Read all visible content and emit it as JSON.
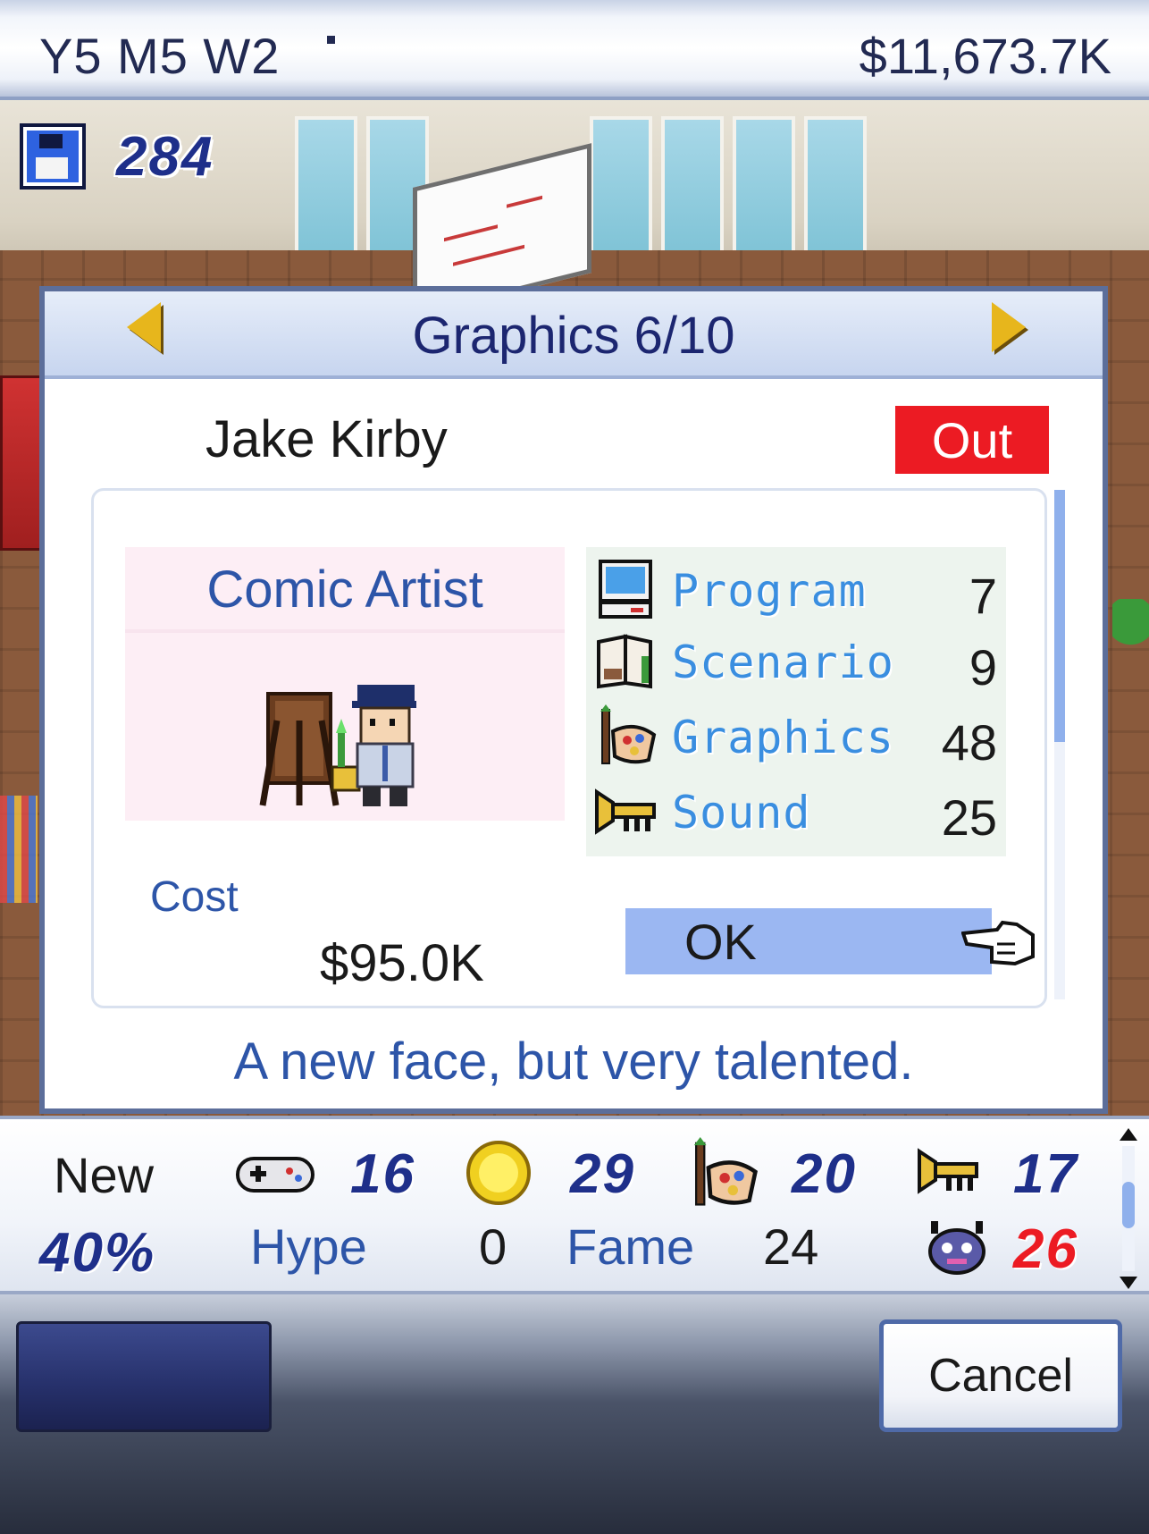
{
  "topbar": {
    "date": "Y5 M5 W2",
    "money": "$11,673.7K"
  },
  "save": {
    "count": "284",
    "icon": "floppy-disk-icon"
  },
  "dialog": {
    "title": "Graphics 6/10",
    "name": "Jake Kirby",
    "status": "Out",
    "job_title": "Comic Artist",
    "stats": [
      {
        "label": "Program",
        "value": "7",
        "icon": "computer-icon"
      },
      {
        "label": "Scenario",
        "value": "9",
        "icon": "book-icon"
      },
      {
        "label": "Graphics",
        "value": "48",
        "icon": "paint-palette-icon"
      },
      {
        "label": "Sound",
        "value": "25",
        "icon": "trumpet-icon"
      }
    ],
    "cost_label": "Cost",
    "cost_value": "$95.0K",
    "ok_label": "OK",
    "flavor": "A new face, but very talented."
  },
  "status_panel": {
    "state": "New",
    "percent": "40%",
    "controller_value": "16",
    "coin_value": "29",
    "graphics_value": "20",
    "sound_value": "17",
    "hype_label": "Hype",
    "hype_value": "0",
    "fame_label": "Fame",
    "fame_value": "24",
    "bugs_value": "26"
  },
  "bottom": {
    "cancel_label": "Cancel"
  },
  "colors": {
    "status_out": "#ec1b23",
    "ok_button": "#9bb7f2",
    "accent_blue": "#2d55a8",
    "bug_red": "#ec1b23"
  }
}
